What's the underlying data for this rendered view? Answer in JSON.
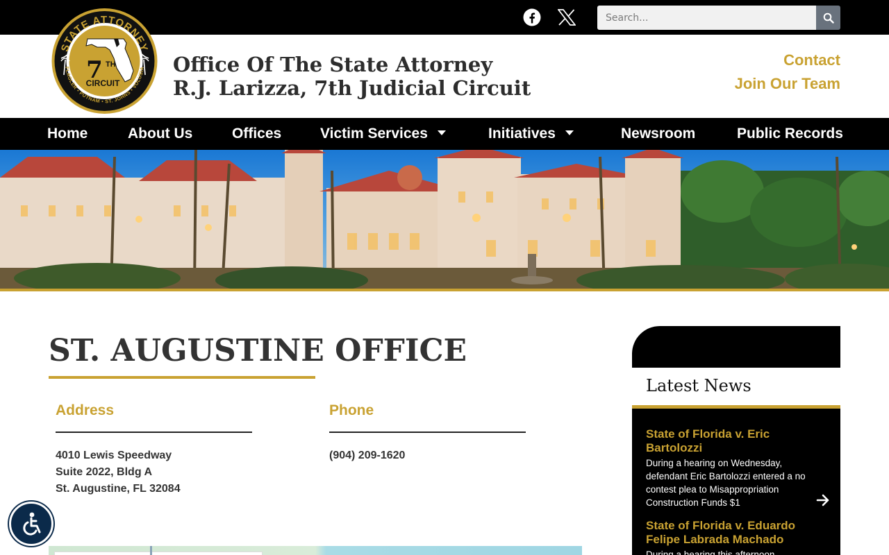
{
  "topbar": {
    "social": [
      {
        "name": "Facebook",
        "icon": "facebook-icon"
      },
      {
        "name": "X",
        "icon": "x-twitter-icon"
      }
    ],
    "search": {
      "placeholder": "Search...",
      "value": "",
      "icon": "search-icon"
    }
  },
  "header": {
    "logo": {
      "ring_top": "STATE ATTORNEY",
      "center_number": "7",
      "center_suffix": "TH",
      "center_word": "CIRCUIT",
      "ring_bottom": "FLAGLER • PUTNAM • ST. JOHNS • VOLUSIA"
    },
    "title_line1": "Office Of The State Attorney",
    "title_line2": "R.J. Larizza, 7th Judicial Circuit",
    "links": {
      "contact": "Contact",
      "join": "Join Our Team"
    }
  },
  "nav": {
    "items": [
      {
        "label": "Home",
        "has_dropdown": false
      },
      {
        "label": "About Us",
        "has_dropdown": false
      },
      {
        "label": "Offices",
        "has_dropdown": false
      },
      {
        "label": "Victim Services",
        "has_dropdown": true
      },
      {
        "label": "Initiatives",
        "has_dropdown": true
      },
      {
        "label": "Newsroom",
        "has_dropdown": false
      },
      {
        "label": "Public Records",
        "has_dropdown": false
      }
    ]
  },
  "main": {
    "title": "ST. AUGUSTINE OFFICE",
    "address": {
      "heading": "Address",
      "line1": "4010 Lewis Speedway",
      "line2": "Suite 2022, Bldg A",
      "line3": "St. Augustine, FL 32084"
    },
    "phone": {
      "heading": "Phone",
      "number": "(904) 209-1620"
    }
  },
  "sidebar": {
    "title": "Latest News",
    "news": [
      {
        "title": "State of Florida v. Eric Bartolozzi",
        "excerpt": "During a hearing on Wednesday, defendant Eric Bartolozzi entered a no contest plea to Misappropriation Construction Funds $1"
      },
      {
        "title": "State of Florida v. Eduardo Felipe Labrada Machado",
        "excerpt": "During a hearing this afternoon,"
      }
    ],
    "next_icon": "arrow-right-icon"
  },
  "accessibility": {
    "icon": "accessibility-icon"
  },
  "colors": {
    "gold": "#c9a232",
    "black": "#000000",
    "text": "#333333",
    "navy": "#0b2a4a"
  }
}
